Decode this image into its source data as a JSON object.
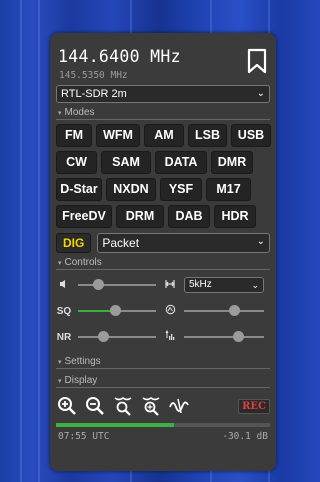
{
  "frequency": {
    "main": "144.6400 MHz",
    "sub": "145.5350 MHz"
  },
  "profile": {
    "selected": "RTL-SDR 2m"
  },
  "sections": {
    "modes": "Modes",
    "controls": "Controls",
    "settings": "Settings",
    "display": "Display"
  },
  "modes": [
    [
      "FM",
      "WFM",
      "AM",
      "LSB",
      "USB"
    ],
    [
      "CW",
      "SAM",
      "DATA",
      "DMR"
    ],
    [
      "D-Star",
      "NXDN",
      "YSF",
      "M17"
    ],
    [
      "FreeDV",
      "DRM",
      "DAB",
      "HDR"
    ]
  ],
  "digital": {
    "label": "DIG",
    "selected": "Packet"
  },
  "controls": {
    "volume": 0.25,
    "squelch": 0.48,
    "squelch_fill": 0.48,
    "nr": 0.32,
    "agc": 0.63,
    "nr_right": 0.68,
    "step": "5kHz",
    "labels": {
      "sq": "SQ",
      "nr": "NR"
    }
  },
  "recording": {
    "label": "REC"
  },
  "status": {
    "time": "07:55 UTC",
    "level": "-30.1 dB",
    "progress": 0.55
  },
  "colors": {
    "accent": "#3cb043",
    "dig": "#f0d700",
    "rec": "#e04040"
  },
  "icons": [
    "bookmark-icon",
    "volume-icon",
    "step-icon",
    "squelch-icon",
    "agc-icon",
    "nr-icon",
    "zoom-in-icon",
    "zoom-out-icon",
    "zoom-fit-icon",
    "zoom-center-icon",
    "waveform-icon"
  ]
}
